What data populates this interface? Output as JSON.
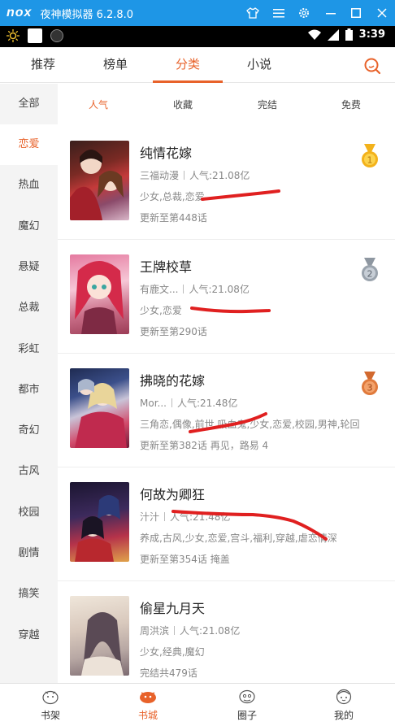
{
  "emulator": {
    "logo": "nox",
    "title": "夜神模拟器 6.2.8.0"
  },
  "status": {
    "time": "3:39"
  },
  "tabs": [
    {
      "label": "推荐"
    },
    {
      "label": "榜单"
    },
    {
      "label": "分类"
    },
    {
      "label": "小说"
    }
  ],
  "side": [
    "全部",
    "恋爱",
    "热血",
    "魔幻",
    "悬疑",
    "总裁",
    "彩虹",
    "都市",
    "奇幻",
    "古风",
    "校园",
    "剧情",
    "搞笑",
    "穿越"
  ],
  "filters": [
    "人气",
    "收藏",
    "完结",
    "免费"
  ],
  "items": [
    {
      "title": "纯情花嫁",
      "author": "三福动漫",
      "hot": "人气:21.08亿",
      "genres": "少女,总裁,恋爱",
      "update": "更新至第448话",
      "rank": "1"
    },
    {
      "title": "王牌校草",
      "author": "有鹿文...",
      "hot": "人气:21.08亿",
      "genres": "少女,恋爱",
      "update": "更新至第290话",
      "rank": "2"
    },
    {
      "title": "拂晓的花嫁",
      "author": "Mor...",
      "hot": "人气:21.48亿",
      "genres": "三角恋,偶像,前世,吸血鬼,少女,恋爱,校园,男神,轮回",
      "update": "更新至第382话 再见，路易 4",
      "rank": "3"
    },
    {
      "title": "何故为卿狂",
      "author": "汁汁",
      "hot": "人气:21.48亿",
      "genres": "养成,古风,少女,恋爱,宫斗,福利,穿越,虐恋情深",
      "update": "更新至第354话 掩盖"
    },
    {
      "title": "偷星九月天",
      "author": "周洪滨",
      "hot": "人气:21.08亿",
      "genres": "少女,经典,魔幻",
      "update": "完结共479话"
    }
  ],
  "bottom": [
    "书架",
    "书城",
    "圈子",
    "我的"
  ],
  "colors": {
    "accent": "#e8622a",
    "gold": "#f3b21b",
    "silver": "#9aa3ad",
    "bronze": "#e07a3c",
    "emulator": "#1e96e6"
  }
}
